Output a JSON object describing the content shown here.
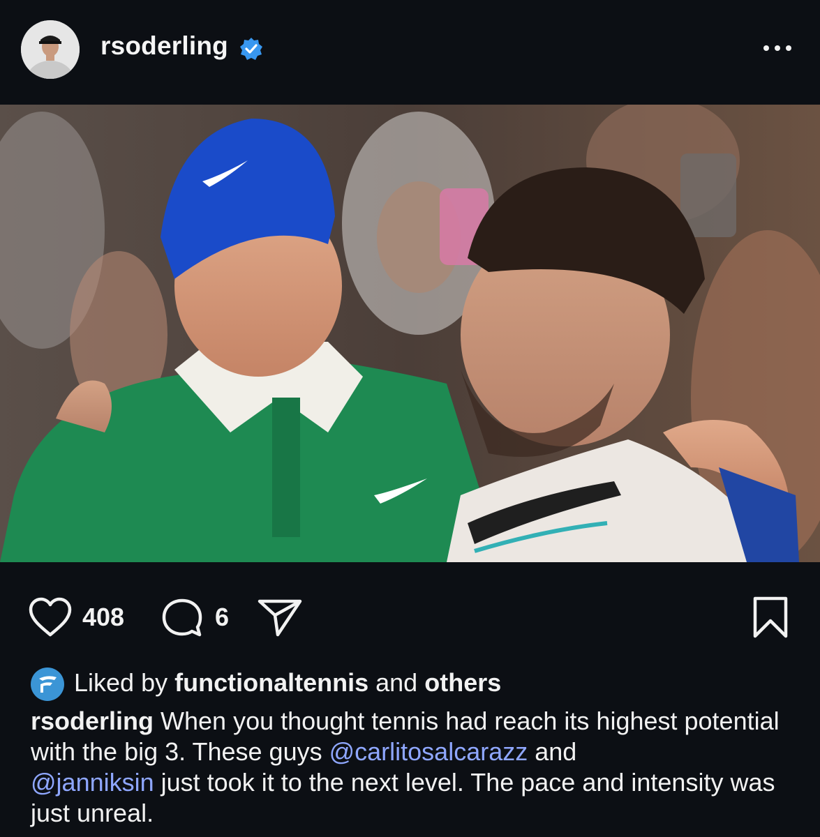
{
  "header": {
    "username": "rsoderling",
    "verified": true,
    "more_icon": "more-horizontal-icon"
  },
  "post": {
    "image_alt": "Two tennis players embracing after a match",
    "likes_count": "408",
    "comments_count": "6"
  },
  "liked_by": {
    "prefix": "Liked by",
    "user": "functionaltennis",
    "connector": "and",
    "others": "others"
  },
  "caption": {
    "author": "rsoderling",
    "text_1": " When you thought tennis had reach its highest potential with the big 3. These guys ",
    "mention_1": "@carlitosalcarazz",
    "text_2": " and",
    "mention_2": "@janniksin",
    "text_3": " just took it to the next level. The pace and intensity was just unreal."
  },
  "colors": {
    "background": "#0c0f14",
    "verified_badge": "#3897f0",
    "mention": "#8fa7ff"
  }
}
